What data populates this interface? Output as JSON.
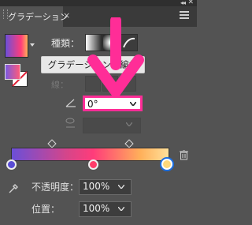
{
  "window": {
    "collapse": "◂◂",
    "close": "✕"
  },
  "tab": {
    "title": "グラデーション",
    "close": "×"
  },
  "panel": {
    "type_label": "種類：",
    "edit_button": "グラデーションを編集",
    "stroke_label": "線：",
    "angle_value": "0°",
    "opacity_label": "不透明度：",
    "opacity_value": "100%",
    "location_label": "位置：",
    "location_value": "100%"
  },
  "colors": {
    "highlight": "#ff2d97",
    "panel_bg": "#535353",
    "gradient_start": "#6b4fd8",
    "gradient_mid": "#ff3c7a",
    "gradient_end": "#ffe09a"
  },
  "gradient_stops": [
    {
      "color": "#5a4dd6"
    },
    {
      "color": "#ff3c6a"
    },
    {
      "color": "#ffd87a",
      "selected": true
    }
  ],
  "icons": [
    "menu-icon",
    "angle-icon",
    "aspect-ratio-icon",
    "trash-icon",
    "eyedropper-icon",
    "swap-icon"
  ]
}
